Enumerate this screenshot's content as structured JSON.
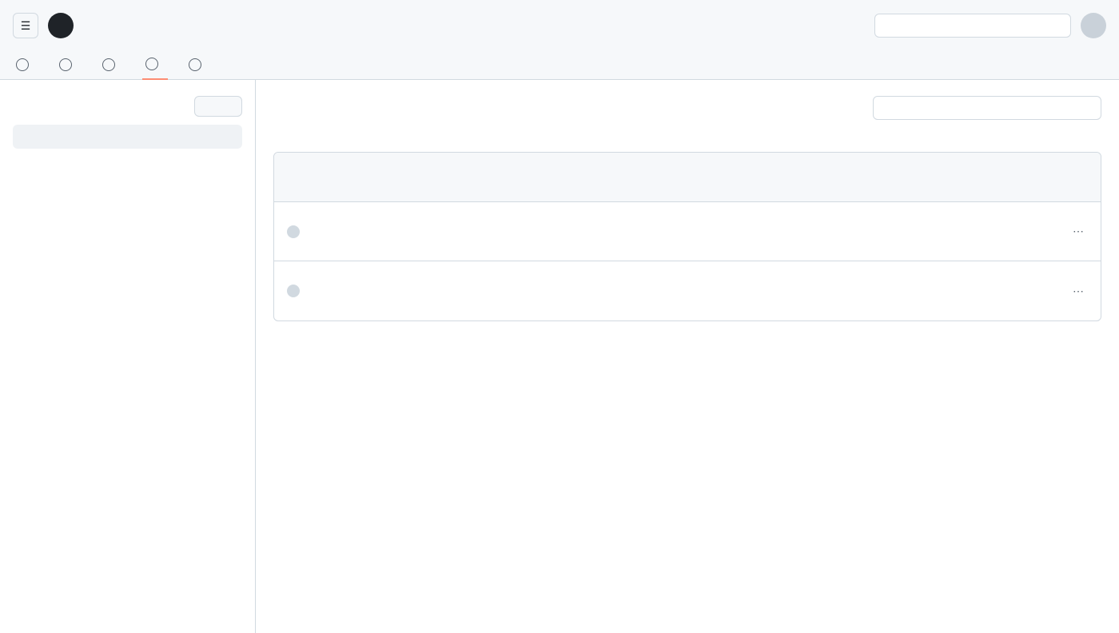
{
  "header": {
    "owner": "",
    "repo": "",
    "search_placeholder": "",
    "tabs": [
      {
        "label": "",
        "selected": false
      },
      {
        "label": "",
        "selected": false
      },
      {
        "label": "",
        "selected": false
      },
      {
        "label": "",
        "selected": true
      },
      {
        "label": "",
        "selected": false
      }
    ]
  },
  "sidebar": {
    "title": "",
    "new_button_label": "",
    "items": [
      {
        "label": "",
        "active": true
      },
      {
        "label": "",
        "active": false
      },
      {
        "label": "",
        "active": false
      }
    ]
  },
  "main": {
    "title": "",
    "subtitle": "",
    "filter_placeholder": "",
    "count_label": "",
    "rows": [
      {
        "title": "",
        "meta": ""
      },
      {
        "title": "",
        "meta": ""
      }
    ]
  },
  "colors": {
    "accent": "#fd8c73",
    "border": "#d1d9e0",
    "surface": "#f6f8fa"
  }
}
